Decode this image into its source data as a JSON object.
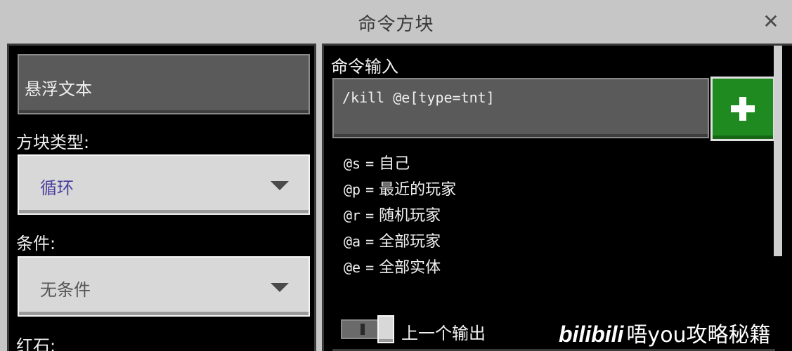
{
  "window": {
    "title": "命令方块",
    "close_label": "✕"
  },
  "left_panel": {
    "hover_text_field": {
      "value": "悬浮文本"
    },
    "block_type": {
      "label": "方块类型:",
      "selected": "循环",
      "selected_color": "#4a3f9e"
    },
    "condition": {
      "label": "条件:",
      "selected": "无条件",
      "selected_color": "#555555"
    },
    "redstone": {
      "label": "红石:"
    }
  },
  "right_panel": {
    "command_label": "命令输入",
    "command_value": "/kill @e[type=tnt]",
    "add_button_icon": "plus-icon",
    "selectors": [
      {
        "code": "@s",
        "eq": "=",
        "desc": "自己"
      },
      {
        "code": "@p",
        "eq": "=",
        "desc": "最近的玩家"
      },
      {
        "code": "@r",
        "eq": "=",
        "desc": "随机玩家"
      },
      {
        "code": "@a",
        "eq": "=",
        "desc": "全部玩家"
      },
      {
        "code": "@e",
        "eq": "=",
        "desc": "全部实体"
      }
    ],
    "previous_output": {
      "label": "上一个输出",
      "enabled": false
    }
  },
  "watermark": {
    "logo": "bilibili",
    "text": "唔you攻略秘籍"
  },
  "colors": {
    "accent_green": "#1f8a1f",
    "panel_bg": "#000000",
    "frame_gray": "#c6c6c6"
  }
}
